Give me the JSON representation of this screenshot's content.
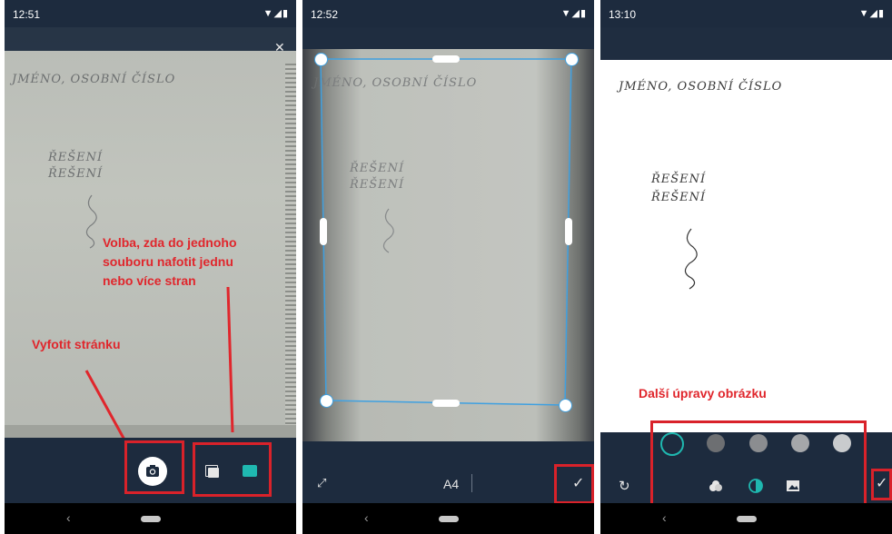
{
  "screens": [
    {
      "status_time": "12:51",
      "handwriting": {
        "line1": "JMÉNO, OSOBNÍ ČÍSLO",
        "line2": "ŘEŠENÍ",
        "line3": "ŘEŠENÍ"
      },
      "annotations": {
        "mode_choice": [
          "Volba, zda do jednoho",
          "souboru nafotit jednu",
          "nebo více stran"
        ],
        "take_photo": "Vyfotit stránku"
      }
    },
    {
      "status_time": "12:52",
      "handwriting": {
        "line1": "JMÉNO, OSOBNÍ ČÍSLO",
        "line2": "ŘEŠENÍ",
        "line3": "ŘEŠENÍ"
      },
      "page_size": "A4"
    },
    {
      "status_time": "13:10",
      "handwriting": {
        "line1": "JMÉNO, OSOBNÍ ČÍSLO",
        "line2": "ŘEŠENÍ",
        "line3": "ŘEŠENÍ"
      },
      "annotations": {
        "more_edits": "Další úpravy obrázku"
      }
    }
  ],
  "colors": {
    "accent": "#1fb8b0",
    "annotation": "#e0262c",
    "toolbar": "#1d2b3e"
  },
  "icons": [
    "flash-off-icon",
    "camera-icon",
    "single-page-icon",
    "multi-page-icon",
    "expand-icon",
    "checkmark-icon",
    "rotate-icon",
    "color-filter-icon",
    "contrast-icon",
    "image-icon",
    "back-icon"
  ]
}
